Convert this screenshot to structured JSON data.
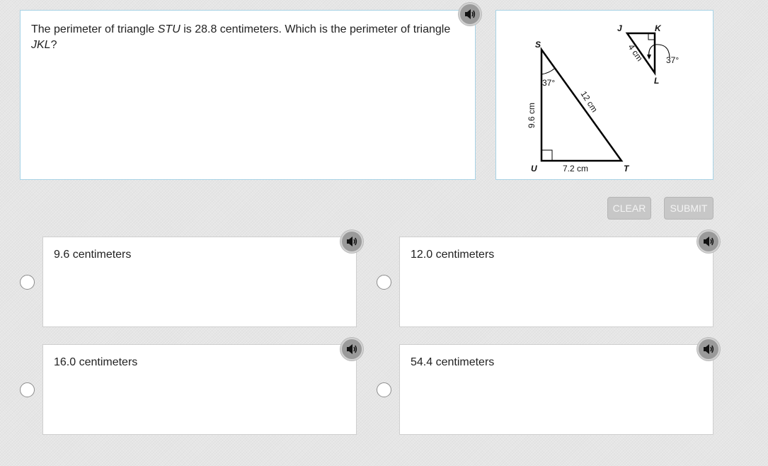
{
  "question": {
    "part1": "The perimeter of triangle ",
    "tri1": "STU",
    "part2": " is 28.8 centimeters.  Which is the perimeter of triangle ",
    "tri2": "JKL",
    "part3": "?"
  },
  "figure": {
    "large_triangle": {
      "vertex_s": "S",
      "vertex_u": "U",
      "vertex_t": "T",
      "angle_label": "37°",
      "side_su": "9.6 cm",
      "side_st": "12 cm",
      "side_ut": "7.2 cm"
    },
    "small_triangle": {
      "vertex_j": "J",
      "vertex_k": "K",
      "vertex_l": "L",
      "side_jl": "4 cm",
      "angle_label": "37°"
    }
  },
  "buttons": {
    "clear": "CLEAR",
    "submit": "SUBMIT"
  },
  "choices": [
    {
      "label": "9.6 centimeters"
    },
    {
      "label": "12.0 centimeters"
    },
    {
      "label": "16.0 centimeters"
    },
    {
      "label": "54.4 centimeters"
    }
  ],
  "icons": {
    "audio": "speaker-icon"
  },
  "colors": {
    "panel_border": "#a8d3e6",
    "button_bg": "#c7c7c7",
    "speaker_bg": "#9a9a9a"
  }
}
